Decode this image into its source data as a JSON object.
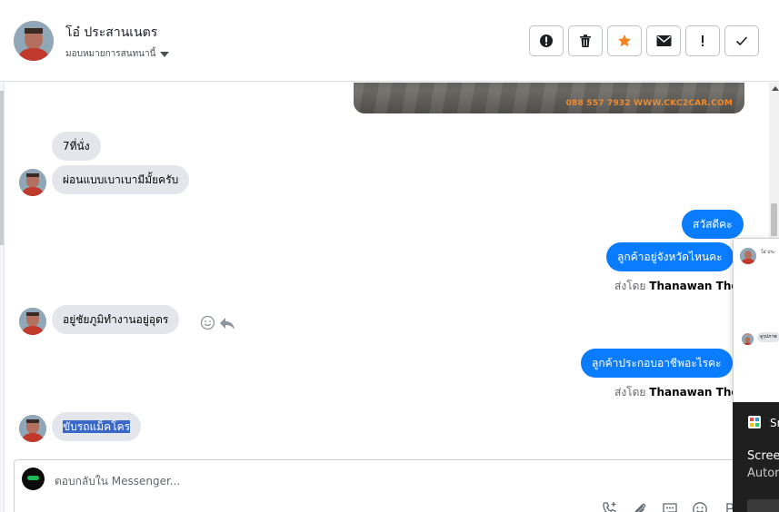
{
  "header": {
    "contact_name": "โอ๋ ประสานเนตร",
    "assign_label": "มอบหมายการสนทนานี้",
    "toolbar": [
      {
        "name": "spam-button",
        "icon": "alert-circle-icon"
      },
      {
        "name": "delete-button",
        "icon": "trash-icon"
      },
      {
        "name": "star-button",
        "icon": "star-icon"
      },
      {
        "name": "mark-unread-button",
        "icon": "envelope-icon"
      },
      {
        "name": "follow-up-button",
        "icon": "exclamation-icon"
      },
      {
        "name": "mark-done-button",
        "icon": "checkmark-icon"
      }
    ]
  },
  "conversation": {
    "image_caption": "088 557 7932 WWW.CKC2CAR.COM",
    "messages": [
      {
        "direction": "in",
        "text": "7ที่นั่ง"
      },
      {
        "direction": "in",
        "text": "ผ่อนแบบเบาเบามีมั้ยครับ"
      },
      {
        "direction": "out",
        "text": "สวัสดีคะ"
      },
      {
        "direction": "out",
        "text": "ลูกค้าอยู่จังหวัดไหนคะ"
      },
      {
        "direction": "in",
        "text": "อยู่ชัยภูมิทำงานอยู่อุดร"
      },
      {
        "direction": "out",
        "text": "ลูกค้าประกอบอาชีพอะไรคะ"
      },
      {
        "direction": "in",
        "text": "ขับรถแม็คโคร"
      }
    ],
    "sent_by_prefix": "ส่งโดย",
    "sent_by_name": "Thanawan Thon"
  },
  "composer": {
    "placeholder": "ตอบกลับใน Messenger..."
  },
  "overlay": {
    "preview_name": "โอ๋ ประ",
    "preview_bubble": "ดูรุปภาพ",
    "app_name": "Sn",
    "title": "Scree",
    "subtitle": "Autor"
  },
  "colors": {
    "outgoing_bubble": "#0a7cff",
    "incoming_bubble": "#e4e6eb",
    "star": "#f5821f",
    "image_caption": "#f08a2c"
  }
}
